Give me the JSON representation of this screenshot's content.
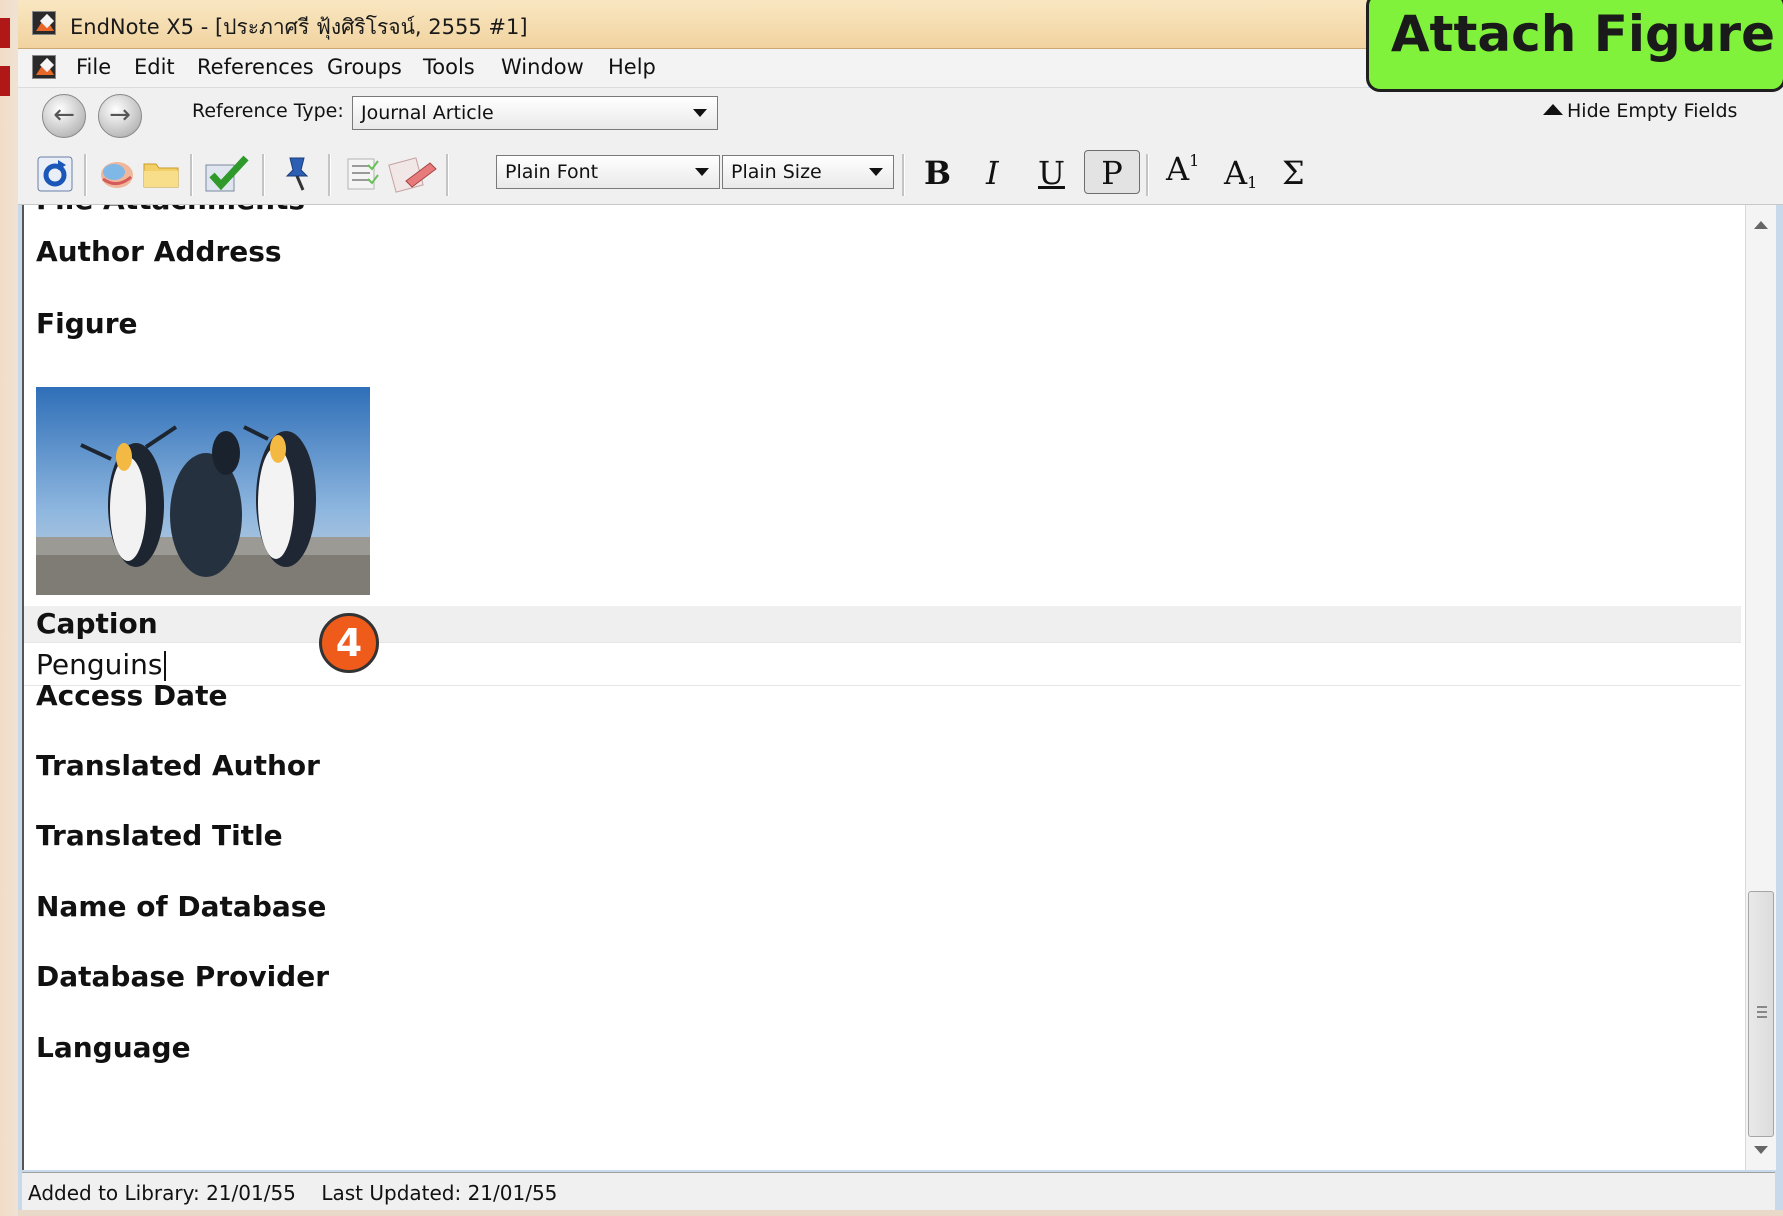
{
  "window": {
    "title": "EndNote X5 - [ประภาศรี ฟุ้งศิริโรจน์, 2555 #1]"
  },
  "callout": {
    "label": "Attach Figure",
    "color": "#80f23c"
  },
  "menu": {
    "items": [
      "File",
      "Edit",
      "References",
      "Groups",
      "Tools",
      "Window",
      "Help"
    ]
  },
  "reference_bar": {
    "type_label": "Reference Type:",
    "type_value": "Journal Article",
    "hide_empty_label": "Hide Empty Fields"
  },
  "toolbar": {
    "font_value": "Plain Font",
    "size_value": "Plain Size",
    "bold": "B",
    "italic": "I",
    "underline": "U",
    "plain": "P",
    "superscript_base": "A",
    "superscript_mark": "1",
    "subscript_base": "A",
    "subscript_mark": "1",
    "symbol": "Σ"
  },
  "fields": {
    "partial_label": "File Attachments",
    "author_address": "Author Address",
    "figure": "Figure",
    "caption": "Caption",
    "caption_value": "Penguins",
    "access_date": "Access Date",
    "translated_author": "Translated Author",
    "translated_title": "Translated Title",
    "name_of_database": "Name of Database",
    "database_provider": "Database Provider",
    "language": "Language"
  },
  "step_badge": {
    "number": "4",
    "color": "#ee5b1a"
  },
  "status": {
    "text": "Added to Library: 21/01/55    Last Updated: 21/01/55"
  }
}
